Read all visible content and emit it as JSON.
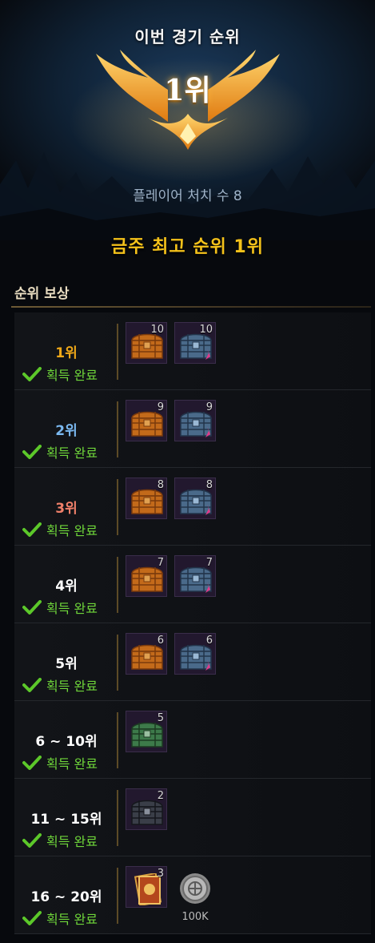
{
  "header": {
    "title": "이번 경기 순위",
    "rank": "1위",
    "kills": "플레이어 처치 수 8",
    "weekly_best": "금주 최고 순위 1위"
  },
  "rewards": {
    "section_title": "순위 보상",
    "status_label": "획득 완료",
    "rows": [
      {
        "rank": "1위",
        "rank_color": "#f0a818",
        "items": [
          {
            "icon": "wooden-chest-icon",
            "count": "10"
          },
          {
            "icon": "steel-chest-icon",
            "count": "10"
          }
        ]
      },
      {
        "rank": "2위",
        "rank_color": "#7ab8f0",
        "items": [
          {
            "icon": "wooden-chest-icon",
            "count": "9"
          },
          {
            "icon": "steel-chest-icon",
            "count": "9"
          }
        ]
      },
      {
        "rank": "3위",
        "rank_color": "#f0806a",
        "items": [
          {
            "icon": "wooden-chest-icon",
            "count": "8"
          },
          {
            "icon": "steel-chest-icon",
            "count": "8"
          }
        ]
      },
      {
        "rank": "4위",
        "rank_color": "#ffffff",
        "items": [
          {
            "icon": "wooden-chest-icon",
            "count": "7"
          },
          {
            "icon": "steel-chest-icon",
            "count": "7"
          }
        ]
      },
      {
        "rank": "5위",
        "rank_color": "#ffffff",
        "items": [
          {
            "icon": "wooden-chest-icon",
            "count": "6"
          },
          {
            "icon": "steel-chest-icon",
            "count": "6"
          }
        ]
      },
      {
        "rank": "6 ~ 10위",
        "rank_color": "#ffffff",
        "items": [
          {
            "icon": "green-chest-icon",
            "count": "5"
          }
        ]
      },
      {
        "rank": "11 ~ 15위",
        "rank_color": "#ffffff",
        "items": [
          {
            "icon": "dark-chest-icon",
            "count": "2"
          }
        ]
      },
      {
        "rank": "16 ~ 20위",
        "rank_color": "#ffffff",
        "items": [
          {
            "icon": "card-pack-icon",
            "count": "3"
          },
          {
            "icon": "silver-coin-icon",
            "count": "",
            "label": "100K"
          }
        ]
      }
    ]
  },
  "colors": {
    "accent_gold": "#f5c21a",
    "status_green": "#6fd63a"
  }
}
